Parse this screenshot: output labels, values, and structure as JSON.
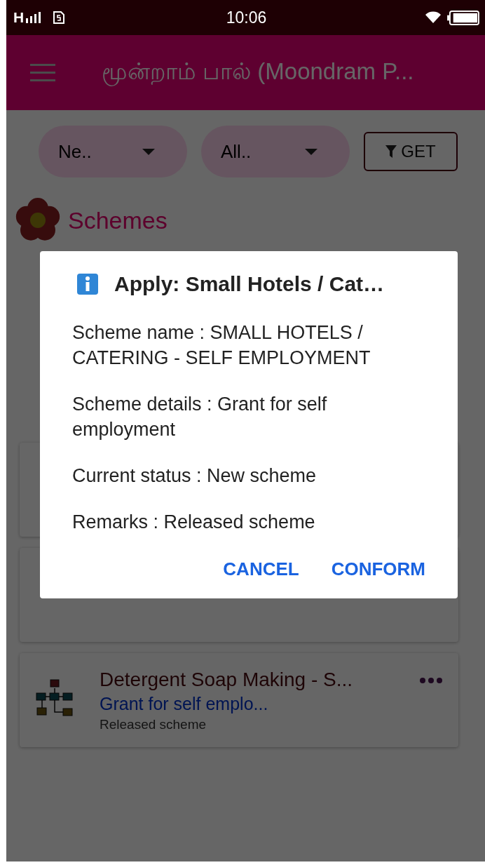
{
  "status_bar": {
    "network": "H",
    "time": "10:06"
  },
  "app_bar": {
    "title": "மூன்றாம் பால் (Moondram P..."
  },
  "filters": [
    {
      "value": "Ne.."
    },
    {
      "value": "All.."
    }
  ],
  "get_button": {
    "label": "GET"
  },
  "section_title": "Schemes",
  "cards": [
    {
      "kind": "covered"
    },
    {
      "kind": "covered"
    },
    {
      "kind": "scheme",
      "title": "Detergent Soap Making - S...",
      "subtitle": "Grant for self emplo...",
      "remarks": "Released scheme"
    }
  ],
  "dialog": {
    "title": "Apply: Small Hotels / Cat…",
    "lines": [
      "Scheme name : SMALL HOTELS / CATERING - SELF EMPLOYMENT",
      "Scheme details : Grant for self employment",
      "Current status : New scheme",
      "Remarks : Released scheme"
    ],
    "buttons": [
      "CANCEL",
      "CONFORM"
    ]
  }
}
